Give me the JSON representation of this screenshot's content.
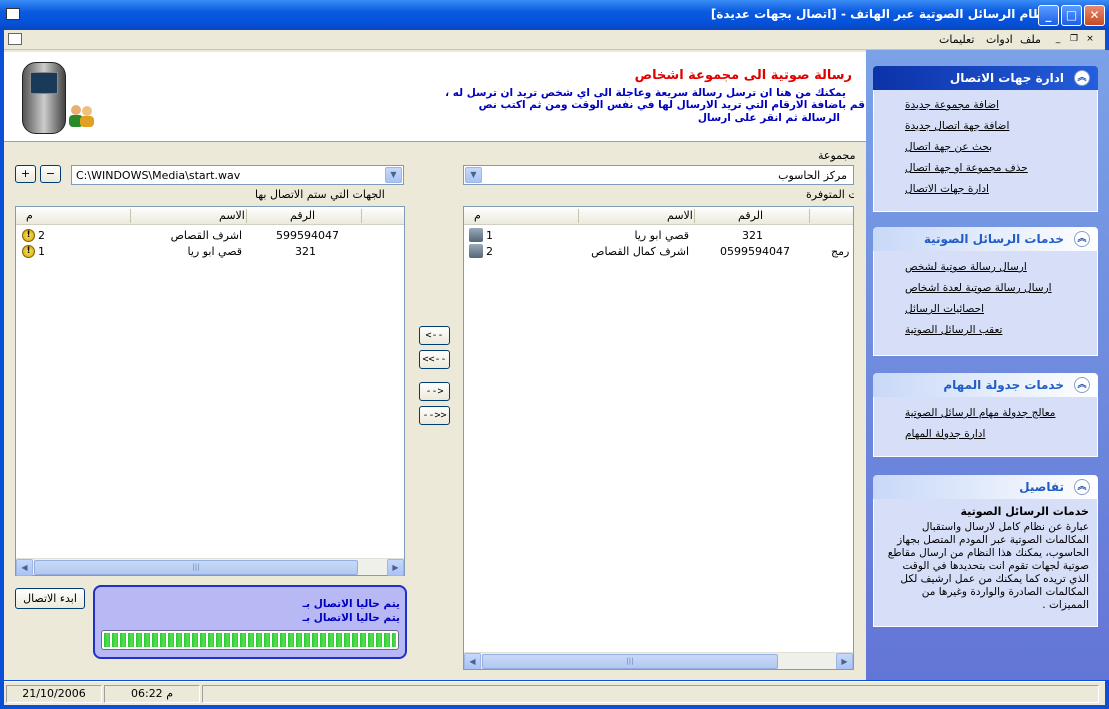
{
  "window": {
    "title": "نظام الرسائل الصوتية عبر الهاتف - [اتصال بجهات عديدة]",
    "min_glyph": "_",
    "max_glyph": "□",
    "close_glyph": "✕"
  },
  "menu": {
    "items": [
      "ملف",
      "ادوات",
      "تعليمات"
    ],
    "mdi_min": "_",
    "mdi_restore": "❐",
    "mdi_close": "×"
  },
  "header": {
    "title": "رسالة صوتية الى مجموعة اشخاص",
    "line1": "يمكنك من هنا ان ترسل رسالة سريعة وعاجلة الى اي شخص تريد ان ترسل له ،",
    "line2": "قم باضافة الارقام التي تريد الارسال لها في نفس الوقت ومن ثم اكتب نص",
    "line3": "الرسالة ثم انقر على ارسال"
  },
  "group": {
    "label": "مجموعة",
    "selected": "مركز الحاسوب",
    "available_label": "الجهات المتوفرة"
  },
  "sound": {
    "file": "C:\\WINDOWS\\Media\\start.wav",
    "minus_label": "−",
    "plus_label": "+"
  },
  "arrow_glyph": "▼",
  "targets": {
    "label": "الجهات التي ستم الاتصال بها",
    "columns": {
      "num": "م",
      "name": "الاسم",
      "number": "الرقم"
    },
    "rows": [
      {
        "idx": "2",
        "name": "اشرف القصاص",
        "number": "599594047",
        "icon": "warning-icon"
      },
      {
        "idx": "1",
        "name": "قصي ابو ريا",
        "number": "321",
        "icon": "warning-icon"
      }
    ]
  },
  "available": {
    "columns": {
      "num": "م",
      "name": "الاسم",
      "number": "الرقم"
    },
    "rows": [
      {
        "idx": "1",
        "name": "قصي ابو ريا",
        "number": "321",
        "extra": ""
      },
      {
        "idx": "2",
        "name": "اشرف كمال القصاص",
        "number": "0599594047",
        "extra": "رمج"
      }
    ]
  },
  "transfer": {
    "move_left": "<--",
    "move_all_left": "<<--",
    "move_right": "-->",
    "move_all_right": "-->>"
  },
  "scroll": {
    "left": "◀",
    "right": "▶",
    "grip": "|||"
  },
  "actions": {
    "start_call": "ابدء الاتصال"
  },
  "status": {
    "line1": "يتم حاليا الاتصال بـ",
    "line2": "يتم حاليا الاتصال بـ",
    "progress_pct": 100
  },
  "sidebar": {
    "collapse_glyph": "︽",
    "contacts": {
      "title": "ادارة جهات الاتصال",
      "links": [
        "اضافة مجموعة جديدة",
        "اضافة جهة اتصال جديدة",
        "بحث عن جهة اتصال",
        "حذف مجموعة او جهة اتصال",
        "ادارة جهات الاتصال"
      ]
    },
    "voice": {
      "title": "خدمات الرسائل الصوتية",
      "links": [
        "ارسال رسالة صوتية لشخص",
        "ارسال رسالة صوتية لعدة اشخاص",
        "احصائيات الرسائل",
        "تعقب الرسائل الصوتية"
      ]
    },
    "schedule": {
      "title": "خدمات جدولة المهام",
      "links": [
        "معالج جدولة مهام الرسائل الصوتية",
        "ادارة جدولة المهام"
      ]
    },
    "details": {
      "title": "تفاصيل",
      "heading": "خدمات الرسائل الصوتية",
      "text": "عبارة عن نظام كامل لارسال واستقبال المكالمات الصوتية عبر المودم المتصل بجهاز الحاسوب، يمكنك هذا النظام من ارسال مقاطع صوتية لجهات تقوم انت بتحديدها في الوقت الذي تريده كما يمكنك من عمل ارشيف لكل المكالمات الصادرة والواردة وغيرها من المميزات ."
    }
  },
  "statusbar": {
    "date": "21/10/2006",
    "time": "06:22 م"
  }
}
